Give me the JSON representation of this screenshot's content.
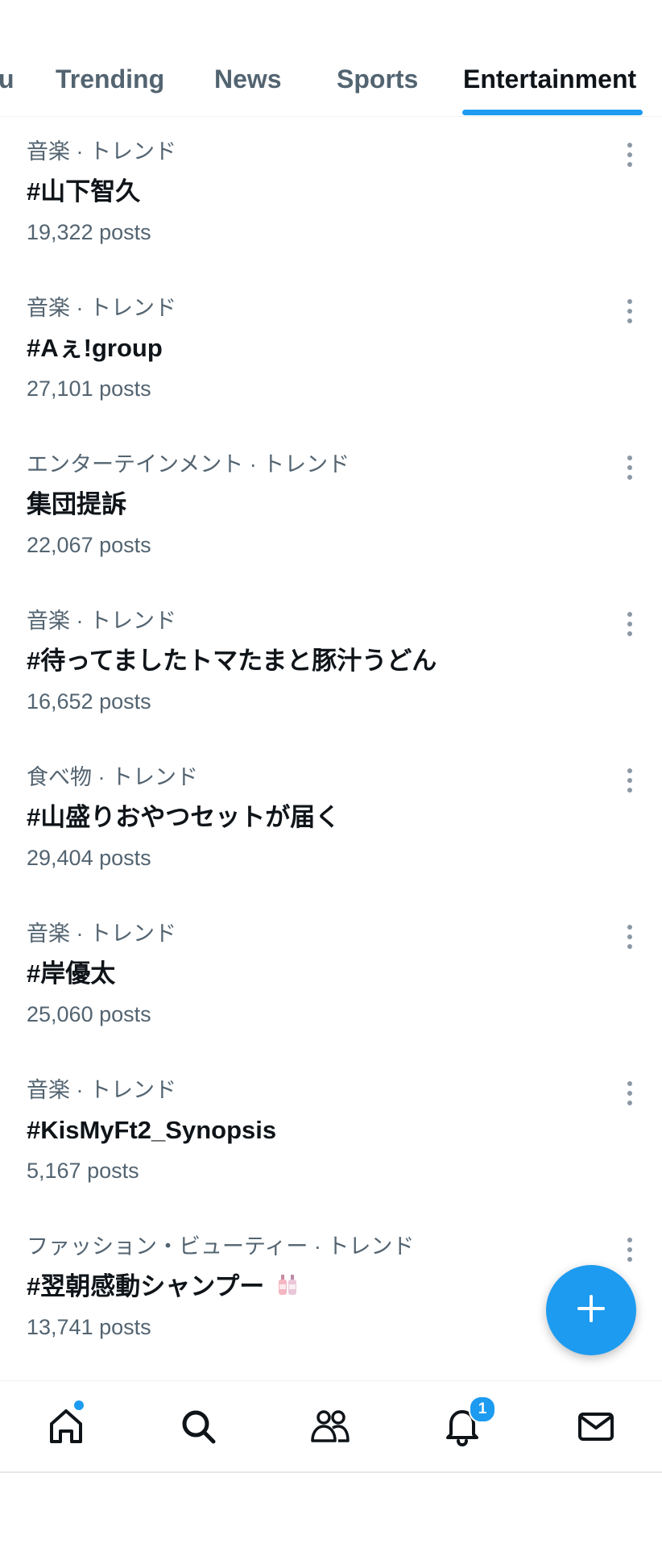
{
  "tabs": [
    {
      "label": "u",
      "active": false
    },
    {
      "label": "Trending",
      "active": false
    },
    {
      "label": "News",
      "active": false
    },
    {
      "label": "Sports",
      "active": false
    },
    {
      "label": "Entertainment",
      "active": true
    }
  ],
  "trends": [
    {
      "category": "音楽 · トレンド",
      "title": "#山下智久",
      "count": "19,322 posts"
    },
    {
      "category": "音楽 · トレンド",
      "title": "#Aぇ!group",
      "count": "27,101 posts"
    },
    {
      "category": "エンターテインメント · トレンド",
      "title": "集団提訴",
      "count": "22,067 posts"
    },
    {
      "category": "音楽 · トレンド",
      "title": "#待ってましたトマたまと豚汁うどん",
      "count": "16,652 posts"
    },
    {
      "category": "食べ物 · トレンド",
      "title": "#山盛りおやつセットが届く",
      "count": "29,404 posts"
    },
    {
      "category": "音楽 · トレンド",
      "title": "#岸優太",
      "count": "25,060 posts"
    },
    {
      "category": "音楽 · トレンド",
      "title": "#KisMyFt2_Synopsis",
      "count": "5,167 posts"
    },
    {
      "category": "ファッション・ビューティー · トレンド",
      "title": "#翌朝感動シャンプー",
      "count": "13,741 posts"
    }
  ],
  "nav": {
    "items": [
      "home-icon",
      "search-icon",
      "communities-icon",
      "notifications-icon",
      "messages-icon"
    ],
    "notifications_badge": "1"
  },
  "colors": {
    "accent": "#1d9bf0",
    "primary_text": "#0f1419",
    "secondary_text": "#536471",
    "divider": "#eff3f4"
  }
}
